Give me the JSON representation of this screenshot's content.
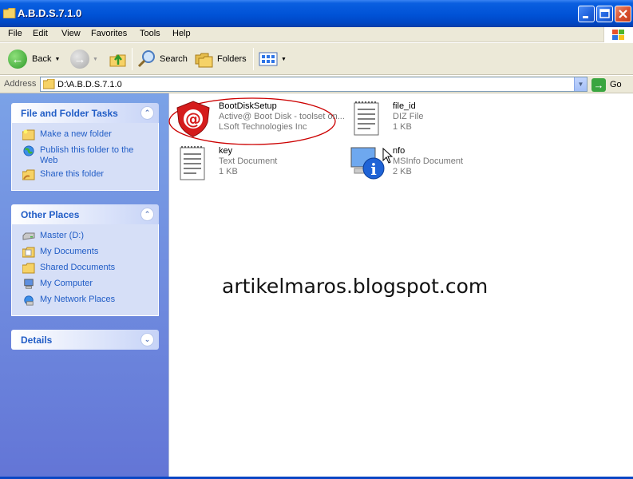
{
  "window": {
    "title": "A.B.D.S.7.1.0"
  },
  "menu": {
    "items": [
      "File",
      "Edit",
      "View",
      "Favorites",
      "Tools",
      "Help"
    ]
  },
  "toolbar": {
    "back_label": "Back",
    "search_label": "Search",
    "folders_label": "Folders",
    "icons": {
      "back": "back-arrow-icon",
      "forward": "forward-arrow-icon",
      "up": "up-folder-icon",
      "search": "magnifier-icon",
      "folders": "folders-icon",
      "views": "views-grid-icon"
    }
  },
  "address": {
    "label": "Address",
    "value": "D:\\A.B.D.S.7.1.0",
    "go_label": "Go"
  },
  "sidebar": {
    "tasks": {
      "title": "File and Folder Tasks",
      "items": [
        {
          "label": "Make a new folder",
          "icon": "new-folder-icon"
        },
        {
          "label": "Publish this folder to the Web",
          "icon": "globe-icon"
        },
        {
          "label": "Share this folder",
          "icon": "share-folder-icon"
        }
      ]
    },
    "places": {
      "title": "Other Places",
      "items": [
        {
          "label": "Master (D:)",
          "icon": "drive-icon"
        },
        {
          "label": "My Documents",
          "icon": "my-documents-icon"
        },
        {
          "label": "Shared Documents",
          "icon": "shared-documents-icon"
        },
        {
          "label": "My Computer",
          "icon": "my-computer-icon"
        },
        {
          "label": "My Network Places",
          "icon": "network-places-icon"
        }
      ]
    },
    "details": {
      "title": "Details"
    }
  },
  "files": [
    {
      "name": "BootDiskSetup",
      "line1": "Active@ Boot Disk - toolset on...",
      "line2": "LSoft Technologies Inc",
      "icon": "active-boot-disk-icon"
    },
    {
      "name": "file_id",
      "line1": "DIZ File",
      "line2": "1 KB",
      "icon": "text-document-icon"
    },
    {
      "name": "key",
      "line1": "Text Document",
      "line2": "1 KB",
      "icon": "text-document-icon"
    },
    {
      "name": "nfo",
      "line1": "MSInfo Document",
      "line2": "2 KB",
      "icon": "msinfo-icon"
    }
  ],
  "watermark": "artikelmaros.blogspot.com",
  "colors": {
    "titlebar": "#0052d6",
    "sidebar_link": "#215dc6",
    "highlight": "#cc0000"
  }
}
